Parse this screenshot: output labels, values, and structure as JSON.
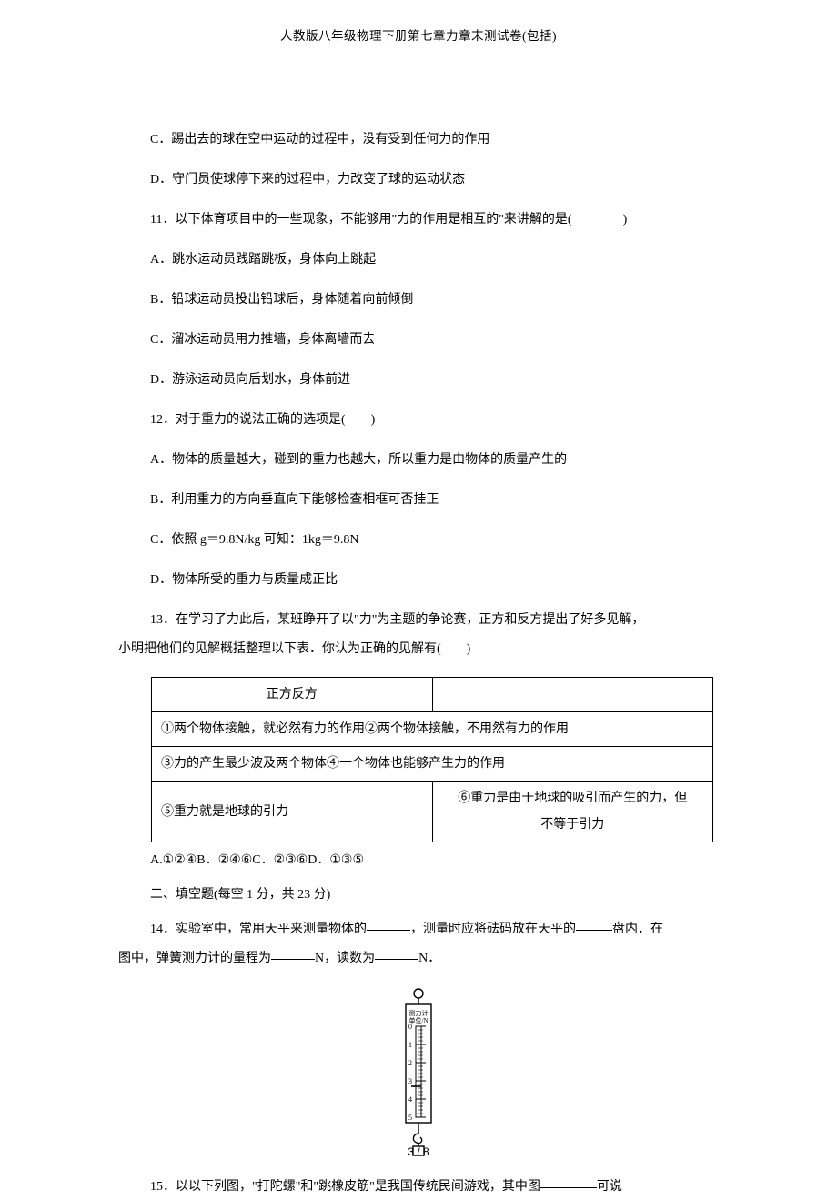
{
  "header": {
    "title": "人教版八年级物理下册第七章力章末测试卷(包括)"
  },
  "body": {
    "optC": "C．踢出去的球在空中运动的过程中，没有受到任何力的作用",
    "optD": "D．守门员使球停下来的过程中，力改变了球的运动状态",
    "q11": "11．以下体育项目中的一些现象，不能够用\"力的作用是相互的\"来讲解的是(　　　　)",
    "q11A": "A．跳水运动员践踏跳板，身体向上跳起",
    "q11B": "B．铅球运动员投出铅球后，身体随着向前倾倒",
    "q11C": "C．溜冰运动员用力推墙，身体离墙而去",
    "q11D": "D．游泳运动员向后划水，身体前进",
    "q12": "12．对于重力的说法正确的选项是(　　)",
    "q12A": "A．物体的质量越大，碰到的重力也越大，所以重力是由物体的质量产生的",
    "q12B": "B．利用重力的方向垂直向下能够检查相框可否挂正",
    "q12C": "C．依照 g＝9.8N/kg 可知：1kg＝9.8N",
    "q12D": "D．物体所受的重力与质量成正比",
    "q13a": "13．在学习了力此后，某班睁开了以\"力\"为主题的争论赛，正方和反方提出了好多见解，",
    "q13b": "小明把他们的见解概括整理以下表．你认为正确的见解有(　　)",
    "table": {
      "r1c1": "正方反方",
      "r1c2": "",
      "r2": "①两个物体接触，就必然有力的作用②两个物体接触，不用然有力的作用",
      "r3": "③力的产生最少波及两个物体④一个物体也能够产生力的作用",
      "r4c1": "⑤重力就是地球的引力",
      "r4c2a": "⑥重力是由于地球的吸引而产生的力，但",
      "r4c2b": "不等于引力"
    },
    "q13opts": "A.①②④B．②④⑥C．②③⑥D．①③⑤",
    "section2": "二、填空题(每空 1 分，共 23 分)",
    "q14a": "14．实验室中，常用天平来测量物体的",
    "q14b": "，测量时应将砝码放在天平的",
    "q14c": "盘内．在",
    "q14d": "图中，弹簧测力计的量程为",
    "q14e": "N，读数为",
    "q14f": "N．",
    "dynamo": {
      "label1": "测力计",
      "label2": "单位/N",
      "ticks": [
        "0",
        "1",
        "2",
        "3",
        "4",
        "5"
      ]
    },
    "q15a": "15．以以下列图，\"打陀螺\"和\"跳橡皮筋\"是我国传统民间游戏，其中图",
    "q15b": "可说"
  },
  "footer": {
    "page": "3 / 8"
  }
}
